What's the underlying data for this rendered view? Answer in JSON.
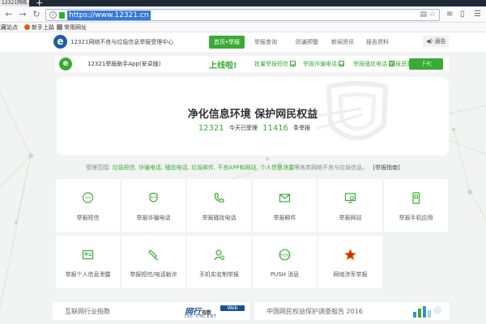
{
  "browser": {
    "tab_title": "12321网络...",
    "url": "https://www.12321.cn",
    "bookmarks": [
      "收藏站点",
      "新手上路",
      "常用网址"
    ]
  },
  "site": {
    "name": "12321网络不良与垃圾信息举报受理中心",
    "nav": [
      "首页•举报",
      "举报查询",
      "防骗预警",
      "新闻资讯",
      "报告资料"
    ],
    "notice": "通告"
  },
  "app_bar": {
    "text": "12321举报助手App(安卓版)",
    "launch": "上线啦!",
    "features": [
      "批量举报短信",
      "举报诈骗电话",
      "举报骚扰电话",
      "举报恶意应用"
    ],
    "download": "下载"
  },
  "hero": {
    "title": "净化信息环境 保护网民权益",
    "received_count": "12321",
    "received_label": "今天已受理",
    "reports_count": "11416",
    "reports_label": "条举报"
  },
  "scope": {
    "prefix": "受理范围:",
    "items": [
      "垃圾短信",
      "诈骗电话",
      "骚扰电话",
      "垃圾邮件",
      "不良APP和网站",
      "个人信息泄露"
    ],
    "suffix": "等各类网络不良与垃圾信息。",
    "guide": "[举报指南]"
  },
  "tiles": [
    {
      "label": "举报短信",
      "icon": "sms-bubble-icon"
    },
    {
      "label": "举报诈骗电话",
      "icon": "fraud-mask-icon"
    },
    {
      "label": "举报骚扰电话",
      "icon": "phone-icon"
    },
    {
      "label": "举报邮件",
      "icon": "mail-icon"
    },
    {
      "label": "举报网站",
      "icon": "website-monitor-icon"
    },
    {
      "label": "举报手机应用",
      "icon": "mobile-app-icon"
    },
    {
      "label": "举报个人信息泄露",
      "icon": "id-card-icon"
    },
    {
      "label": "举报短信/电话勒诈",
      "icon": "extortion-icon"
    },
    {
      "label": "手机实名制举报",
      "icon": "real-name-icon"
    },
    {
      "label": "PUSH 消息",
      "icon": "push-message-icon"
    },
    {
      "label": "网络涉军举报",
      "icon": "military-star-icon"
    }
  ],
  "banners": {
    "left_text": "互联网行业指数",
    "index_logo": "网行",
    "index_small": "指数",
    "index_box": "Web Index",
    "index_sub": "ISC·CNCERT",
    "right_text": "中国网民权益保护调查报告 2016"
  },
  "colors": {
    "brand_green": "#3aaa35",
    "brand_blue": "#1f5f9e",
    "page_bg": "#f2f3f3"
  }
}
